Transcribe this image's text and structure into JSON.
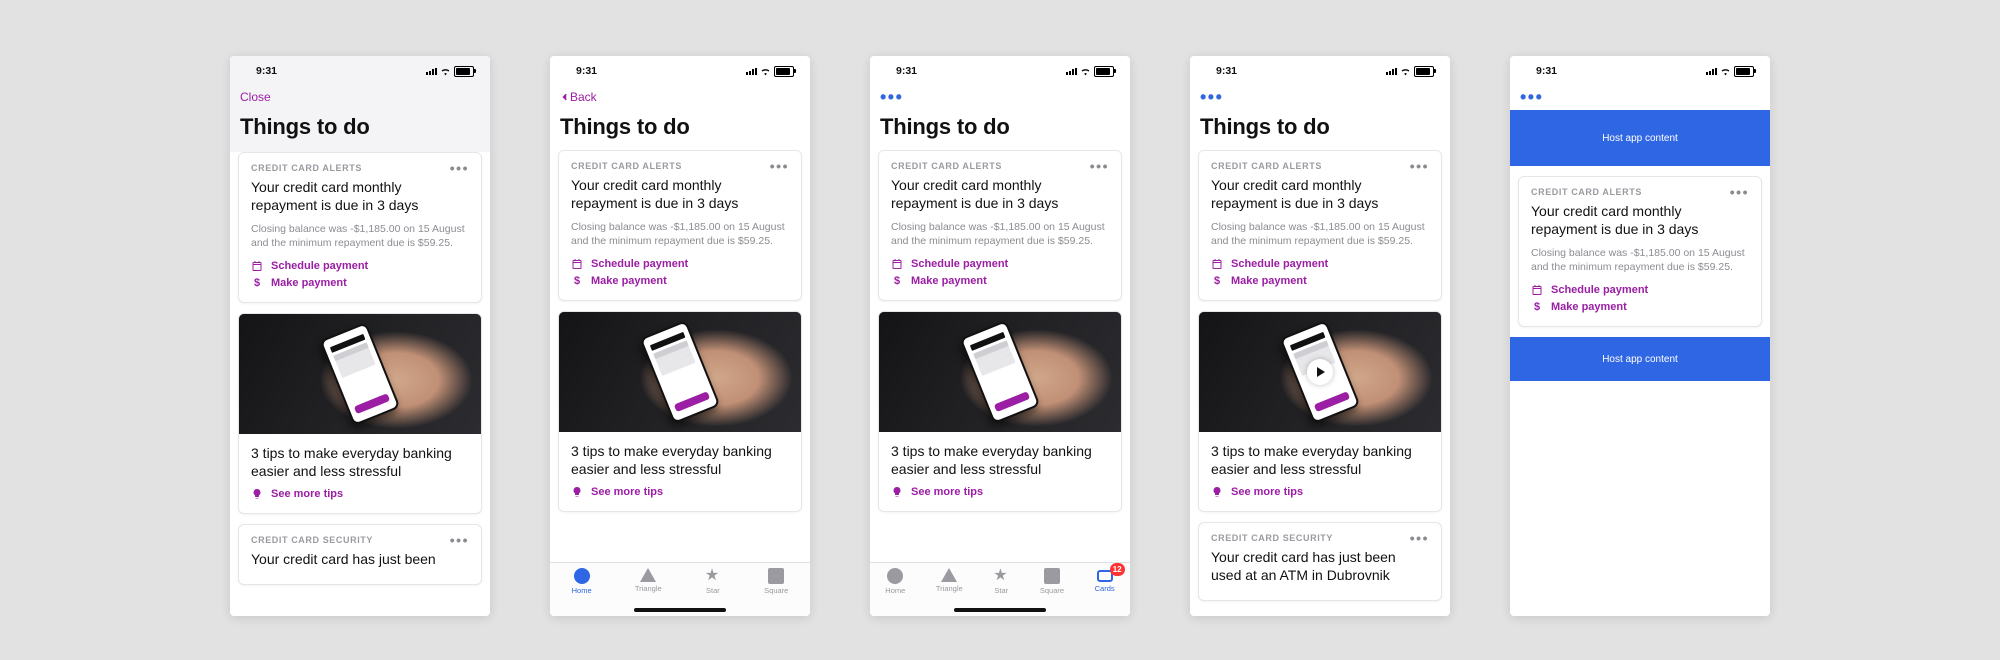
{
  "status": {
    "time": "9:31"
  },
  "nav": {
    "close_label": "Close",
    "back_label": "Back"
  },
  "page": {
    "title": "Things to do"
  },
  "alert_card": {
    "caption": "CREDIT CARD ALERTS",
    "title": "Your credit card monthly repayment is due in 3 days",
    "body": "Closing balance was -$1,185.00 on 15 August and the minimum repayment due is $59.25.",
    "action_schedule": "Schedule payment",
    "action_make": "Make payment"
  },
  "tips_card": {
    "title": "3 tips to make everyday banking easier and less stressful",
    "action": "See more tips"
  },
  "security_card": {
    "caption": "CREDIT CARD SECURITY",
    "title_v1": "Your credit card has just been",
    "title_v4": "Your credit card has just been used at an ATM in Dubrovnik"
  },
  "tabbar": {
    "home": "Home",
    "triangle": "Triangle",
    "star": "Star",
    "square": "Square",
    "cards": "Cards",
    "badge": "12"
  },
  "host_block": {
    "label": "Host app content"
  }
}
